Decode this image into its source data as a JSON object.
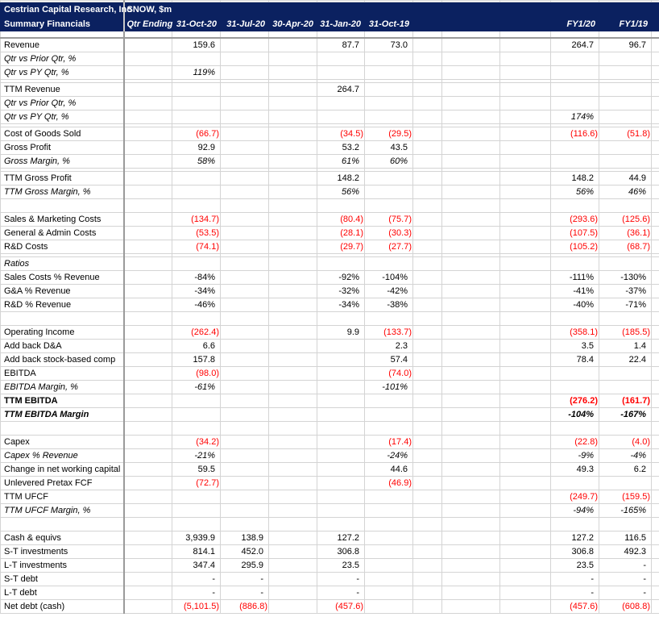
{
  "header": {
    "company": "Cestrian Capital Research, Inc",
    "subtitle": "Summary Financials",
    "ticker": "SNOW, $m",
    "qtr_ending_label": "Qtr Ending",
    "columns": [
      "",
      "31-Oct-20",
      "31-Jul-20",
      "30-Apr-20",
      "31-Jan-20",
      "31-Oct-19",
      "",
      "",
      "",
      "FY1/20",
      "FY1/19"
    ]
  },
  "colors": {
    "header_bg": "#0b2160",
    "negative": "#ff0000",
    "grid": "#d4d4d4"
  },
  "rows": [
    {
      "type": "data",
      "label": "Revenue",
      "style": "",
      "values": [
        "",
        "159.6",
        "",
        "",
        "87.7",
        "73.0",
        "",
        "",
        "",
        "264.7",
        "96.7"
      ]
    },
    {
      "type": "data",
      "label": "Qtr vs Prior Qtr, %",
      "style": "italic",
      "values": [
        "",
        "",
        "",
        "",
        "",
        "",
        "",
        "",
        "",
        "",
        ""
      ]
    },
    {
      "type": "data",
      "label": "Qtr vs PY Qtr, %",
      "style": "italic",
      "values": [
        "",
        "119%",
        "",
        "",
        "",
        "",
        "",
        "",
        "",
        "",
        ""
      ]
    },
    {
      "type": "thin"
    },
    {
      "type": "data",
      "label": "TTM Revenue",
      "style": "",
      "values": [
        "",
        "",
        "",
        "",
        "264.7",
        "",
        "",
        "",
        "",
        "",
        ""
      ]
    },
    {
      "type": "data",
      "label": "Qtr vs Prior Qtr, %",
      "style": "italic",
      "values": [
        "",
        "",
        "",
        "",
        "",
        "",
        "",
        "",
        "",
        "",
        ""
      ]
    },
    {
      "type": "data",
      "label": "Qtr vs PY Qtr, %",
      "style": "italic",
      "values": [
        "",
        "",
        "",
        "",
        "",
        "",
        "",
        "",
        "",
        "174%",
        ""
      ]
    },
    {
      "type": "thin"
    },
    {
      "type": "data",
      "label": "Cost of Goods Sold",
      "style": "",
      "values": [
        "",
        "(66.7)",
        "",
        "",
        "(34.5)",
        "(29.5)",
        "",
        "",
        "",
        "(116.6)",
        "(51.8)"
      ]
    },
    {
      "type": "data",
      "label": "Gross Profit",
      "style": "",
      "values": [
        "",
        "92.9",
        "",
        "",
        "53.2",
        "43.5",
        "",
        "",
        "",
        "",
        ""
      ]
    },
    {
      "type": "data",
      "label": "Gross Margin, %",
      "style": "italic",
      "values": [
        "",
        "58%",
        "",
        "",
        "61%",
        "60%",
        "",
        "",
        "",
        "",
        ""
      ]
    },
    {
      "type": "thin"
    },
    {
      "type": "data",
      "label": "TTM Gross Profit",
      "style": "",
      "values": [
        "",
        "",
        "",
        "",
        "148.2",
        "",
        "",
        "",
        "",
        "148.2",
        "44.9"
      ]
    },
    {
      "type": "data",
      "label": "TTM Gross Margin, %",
      "style": "italic",
      "values": [
        "",
        "",
        "",
        "",
        "56%",
        "",
        "",
        "",
        "",
        "56%",
        "46%"
      ]
    },
    {
      "type": "blank"
    },
    {
      "type": "data",
      "label": "Sales & Marketing Costs",
      "style": "",
      "values": [
        "",
        "(134.7)",
        "",
        "",
        "(80.4)",
        "(75.7)",
        "",
        "",
        "",
        "(293.6)",
        "(125.6)"
      ]
    },
    {
      "type": "data",
      "label": "General & Admin Costs",
      "style": "",
      "values": [
        "",
        "(53.5)",
        "",
        "",
        "(28.1)",
        "(30.3)",
        "",
        "",
        "",
        "(107.5)",
        "(36.1)"
      ]
    },
    {
      "type": "data",
      "label": "R&D Costs",
      "style": "",
      "values": [
        "",
        "(74.1)",
        "",
        "",
        "(29.7)",
        "(27.7)",
        "",
        "",
        "",
        "(105.2)",
        "(68.7)"
      ]
    },
    {
      "type": "thin"
    },
    {
      "type": "data",
      "label": "Ratios",
      "style": "italic",
      "values": [
        "",
        "",
        "",
        "",
        "",
        "",
        "",
        "",
        "",
        "",
        ""
      ]
    },
    {
      "type": "data",
      "label": "Sales Costs % Revenue",
      "style": "",
      "values": [
        "",
        "-84%",
        "",
        "",
        "-92%",
        "-104%",
        "",
        "",
        "",
        "-111%",
        "-130%"
      ]
    },
    {
      "type": "data",
      "label": "G&A % Revenue",
      "style": "",
      "values": [
        "",
        "-34%",
        "",
        "",
        "-32%",
        "-42%",
        "",
        "",
        "",
        "-41%",
        "-37%"
      ]
    },
    {
      "type": "data",
      "label": "R&D % Revenue",
      "style": "",
      "values": [
        "",
        "-46%",
        "",
        "",
        "-34%",
        "-38%",
        "",
        "",
        "",
        "-40%",
        "-71%"
      ]
    },
    {
      "type": "blank"
    },
    {
      "type": "data",
      "label": "Operating Income",
      "style": "",
      "values": [
        "",
        "(262.4)",
        "",
        "",
        "9.9",
        "(133.7)",
        "",
        "",
        "",
        "(358.1)",
        "(185.5)"
      ]
    },
    {
      "type": "data",
      "label": "Add back D&A",
      "style": "",
      "values": [
        "",
        "6.6",
        "",
        "",
        "",
        "2.3",
        "",
        "",
        "",
        "3.5",
        "1.4"
      ]
    },
    {
      "type": "data",
      "label": "Add back stock-based comp",
      "style": "",
      "values": [
        "",
        "157.8",
        "",
        "",
        "",
        "57.4",
        "",
        "",
        "",
        "78.4",
        "22.4"
      ]
    },
    {
      "type": "data",
      "label": "EBITDA",
      "style": "",
      "values": [
        "",
        "(98.0)",
        "",
        "",
        "",
        "(74.0)",
        "",
        "",
        "",
        "",
        ""
      ]
    },
    {
      "type": "data",
      "label": "EBITDA Margin, %",
      "style": "italic",
      "values": [
        "",
        "-61%",
        "",
        "",
        "",
        "-101%",
        "",
        "",
        "",
        "",
        ""
      ]
    },
    {
      "type": "data",
      "label": "TTM EBITDA",
      "style": "bold",
      "values": [
        "",
        "",
        "",
        "",
        "",
        "",
        "",
        "",
        "",
        "(276.2)",
        "(161.7)"
      ]
    },
    {
      "type": "data",
      "label": "TTM EBITDA Margin",
      "style": "bold italic",
      "values": [
        "",
        "",
        "",
        "",
        "",
        "",
        "",
        "",
        "",
        "-104%",
        "-167%"
      ]
    },
    {
      "type": "blank"
    },
    {
      "type": "data",
      "label": "Capex",
      "style": "",
      "values": [
        "",
        "(34.2)",
        "",
        "",
        "",
        "(17.4)",
        "",
        "",
        "",
        "(22.8)",
        "(4.0)"
      ]
    },
    {
      "type": "data",
      "label": "Capex % Revenue",
      "style": "italic",
      "values": [
        "",
        "-21%",
        "",
        "",
        "",
        "-24%",
        "",
        "",
        "",
        "-9%",
        "-4%"
      ]
    },
    {
      "type": "data",
      "label": "Change in net working capital",
      "style": "",
      "values": [
        "",
        "59.5",
        "",
        "",
        "",
        "44.6",
        "",
        "",
        "",
        "49.3",
        "6.2"
      ]
    },
    {
      "type": "data",
      "label": "Unlevered Pretax FCF",
      "style": "",
      "values": [
        "",
        "(72.7)",
        "",
        "",
        "",
        "(46.9)",
        "",
        "",
        "",
        "",
        ""
      ]
    },
    {
      "type": "data",
      "label": "TTM UFCF",
      "style": "",
      "values": [
        "",
        "",
        "",
        "",
        "",
        "",
        "",
        "",
        "",
        "(249.7)",
        "(159.5)"
      ]
    },
    {
      "type": "data",
      "label": "TTM UFCF Margin, %",
      "style": "italic",
      "values": [
        "",
        "",
        "",
        "",
        "",
        "",
        "",
        "",
        "",
        "-94%",
        "-165%"
      ]
    },
    {
      "type": "blank"
    },
    {
      "type": "data",
      "label": "Cash & equivs",
      "style": "",
      "values": [
        "",
        "3,939.9",
        "138.9",
        "",
        "127.2",
        "",
        "",
        "",
        "",
        "127.2",
        "116.5"
      ]
    },
    {
      "type": "data",
      "label": "S-T investments",
      "style": "",
      "values": [
        "",
        "814.1",
        "452.0",
        "",
        "306.8",
        "",
        "",
        "",
        "",
        "306.8",
        "492.3"
      ]
    },
    {
      "type": "data",
      "label": "L-T investments",
      "style": "",
      "values": [
        "",
        "347.4",
        "295.9",
        "",
        "23.5",
        "",
        "",
        "",
        "",
        "23.5",
        "-"
      ]
    },
    {
      "type": "data",
      "label": "S-T debt",
      "style": "",
      "values": [
        "",
        "-",
        "-",
        "",
        "-",
        "",
        "",
        "",
        "",
        "-",
        "-"
      ]
    },
    {
      "type": "data",
      "label": "L-T debt",
      "style": "",
      "values": [
        "",
        "-",
        "-",
        "",
        "-",
        "",
        "",
        "",
        "",
        "-",
        "-"
      ]
    },
    {
      "type": "data",
      "label": "Net debt (cash)",
      "style": "",
      "values": [
        "",
        "(5,101.5)",
        "(886.8)",
        "",
        "(457.6)",
        "",
        "",
        "",
        "",
        "(457.6)",
        "(608.8)"
      ]
    }
  ]
}
